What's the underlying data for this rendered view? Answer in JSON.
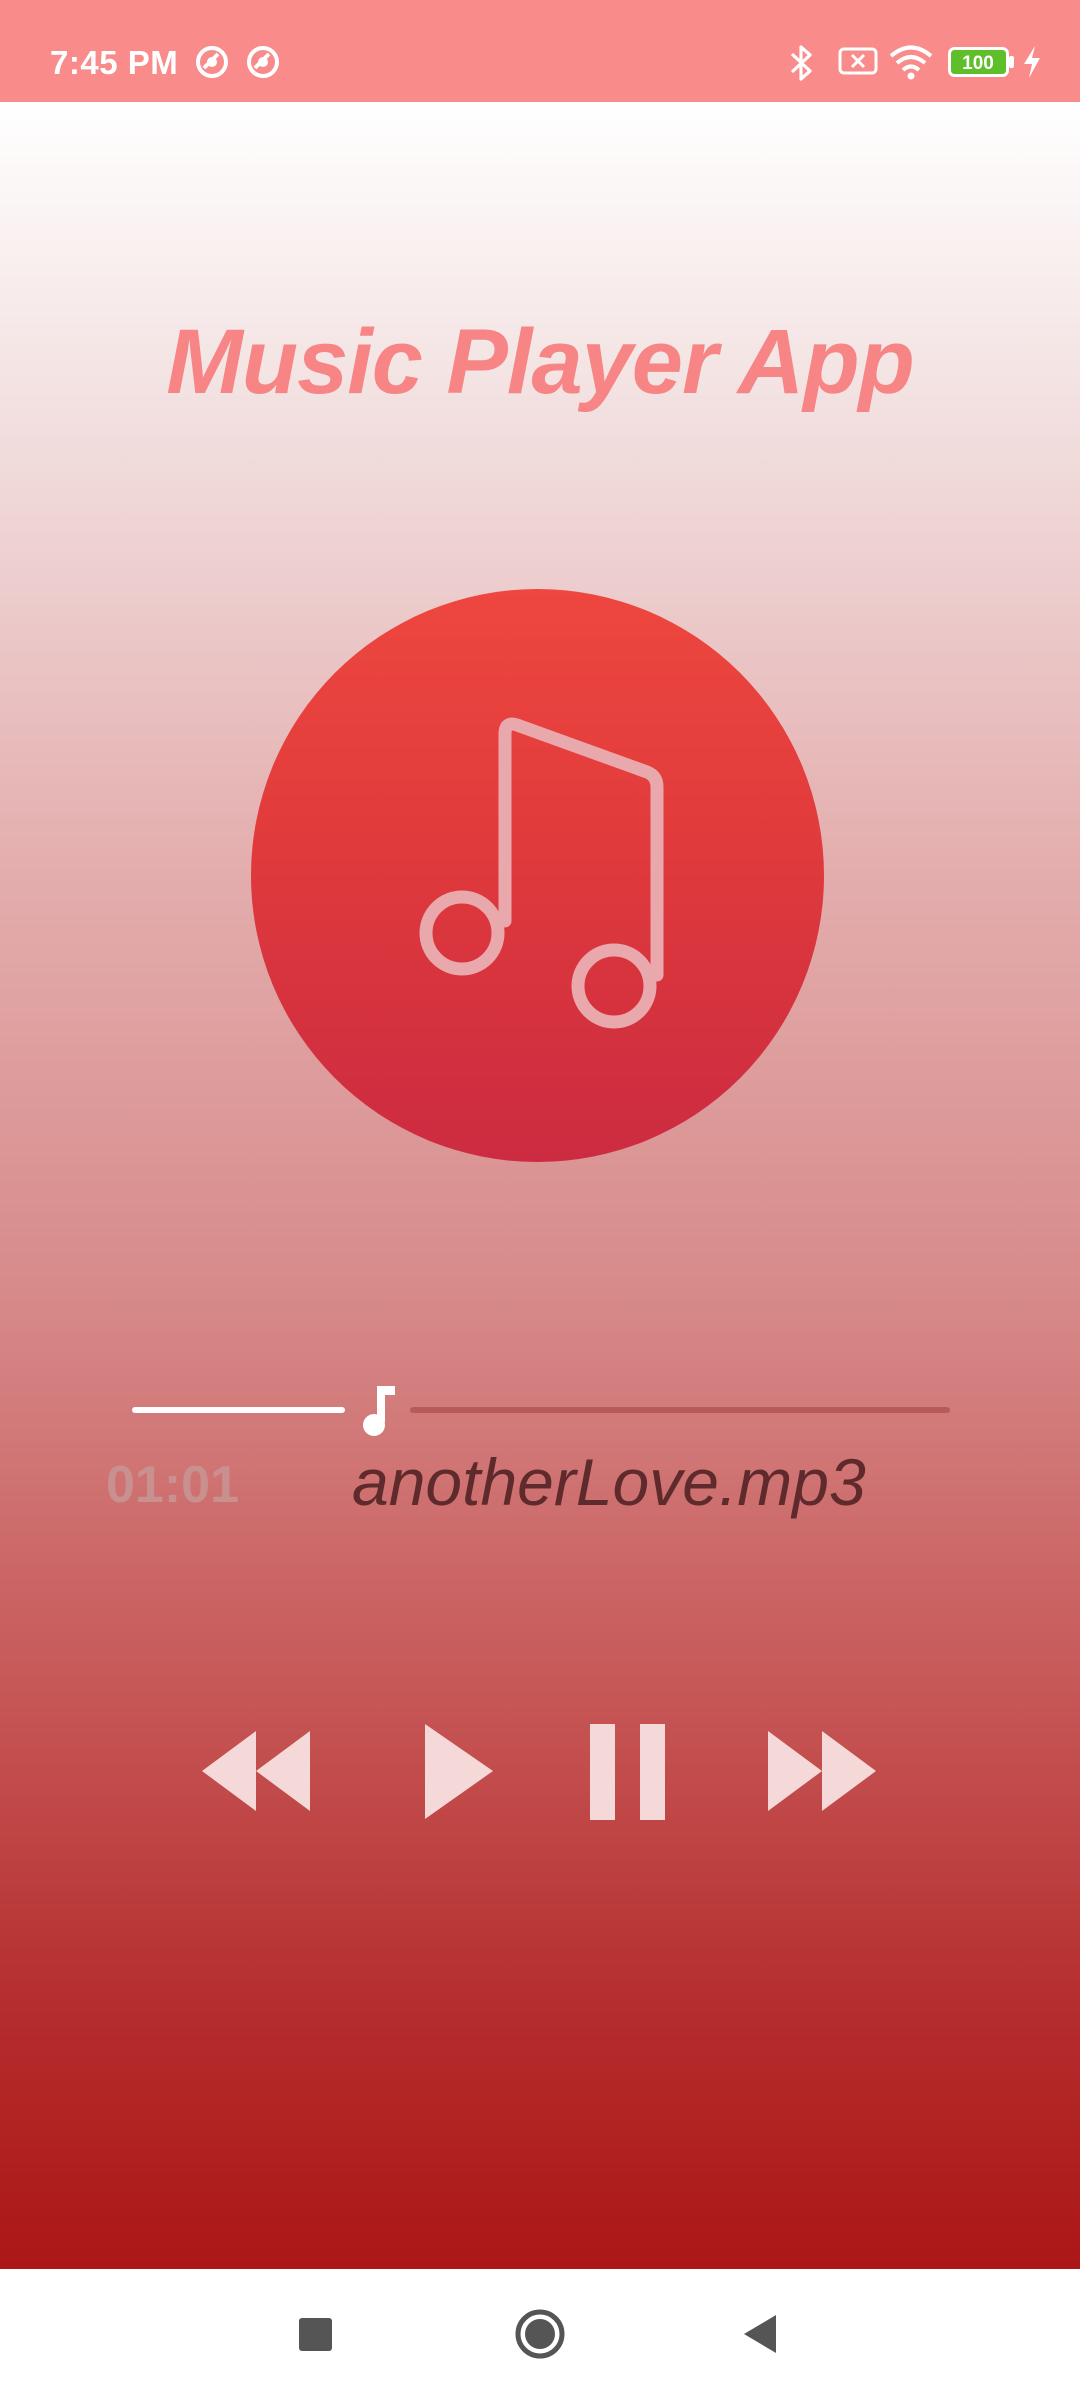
{
  "status_bar": {
    "time": "7:45 PM",
    "battery": "100",
    "icons": [
      "data-saver-icon",
      "data-saver-icon",
      "bluetooth-icon",
      "no-sim-icon",
      "wifi-icon",
      "battery-icon",
      "charging-icon"
    ]
  },
  "app": {
    "title": "Music Player App",
    "album_icon": "music-note-icon",
    "seek_thumb_icon": "music-note-icon",
    "progress": 0.28,
    "elapsed": "01:01",
    "track_name": "anotherLove.mp3",
    "controls": [
      "rewind-icon",
      "play-icon",
      "pause-icon",
      "fast-forward-icon"
    ]
  },
  "nav_bar": {
    "buttons": [
      "recents-icon",
      "home-icon",
      "back-icon"
    ]
  },
  "colors": {
    "status_bar": "#f98b8b",
    "title": "#f78585",
    "album_circle_top": "#ee473f",
    "album_circle_bottom": "#cc2b41",
    "gradient_bottom": "#ac1616",
    "elapsed_text": "#c99090",
    "track_text": "#5f2a2c",
    "control_fill": "#f5d9d9"
  }
}
